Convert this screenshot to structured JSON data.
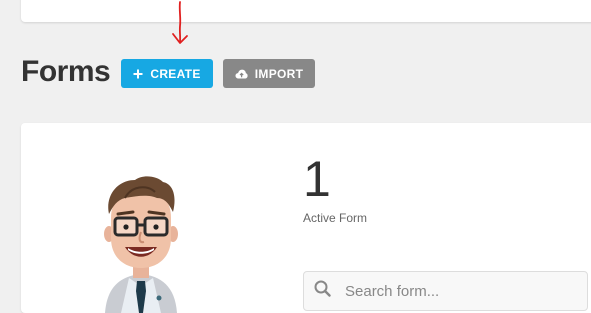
{
  "header": {
    "title": "Forms",
    "create_label": "CREATE",
    "import_label": "IMPORT"
  },
  "stats": {
    "active_count": "1",
    "active_label": "Active Form"
  },
  "search": {
    "placeholder": "Search form..."
  },
  "icons": {
    "create": "plus-icon",
    "import": "cloud-upload-icon",
    "search": "search-icon",
    "annotation": "red-arrow-icon"
  },
  "colors": {
    "primary": "#17a8e3",
    "secondary": "#888888",
    "annotation": "#e02020",
    "background": "#f0f0f0"
  }
}
